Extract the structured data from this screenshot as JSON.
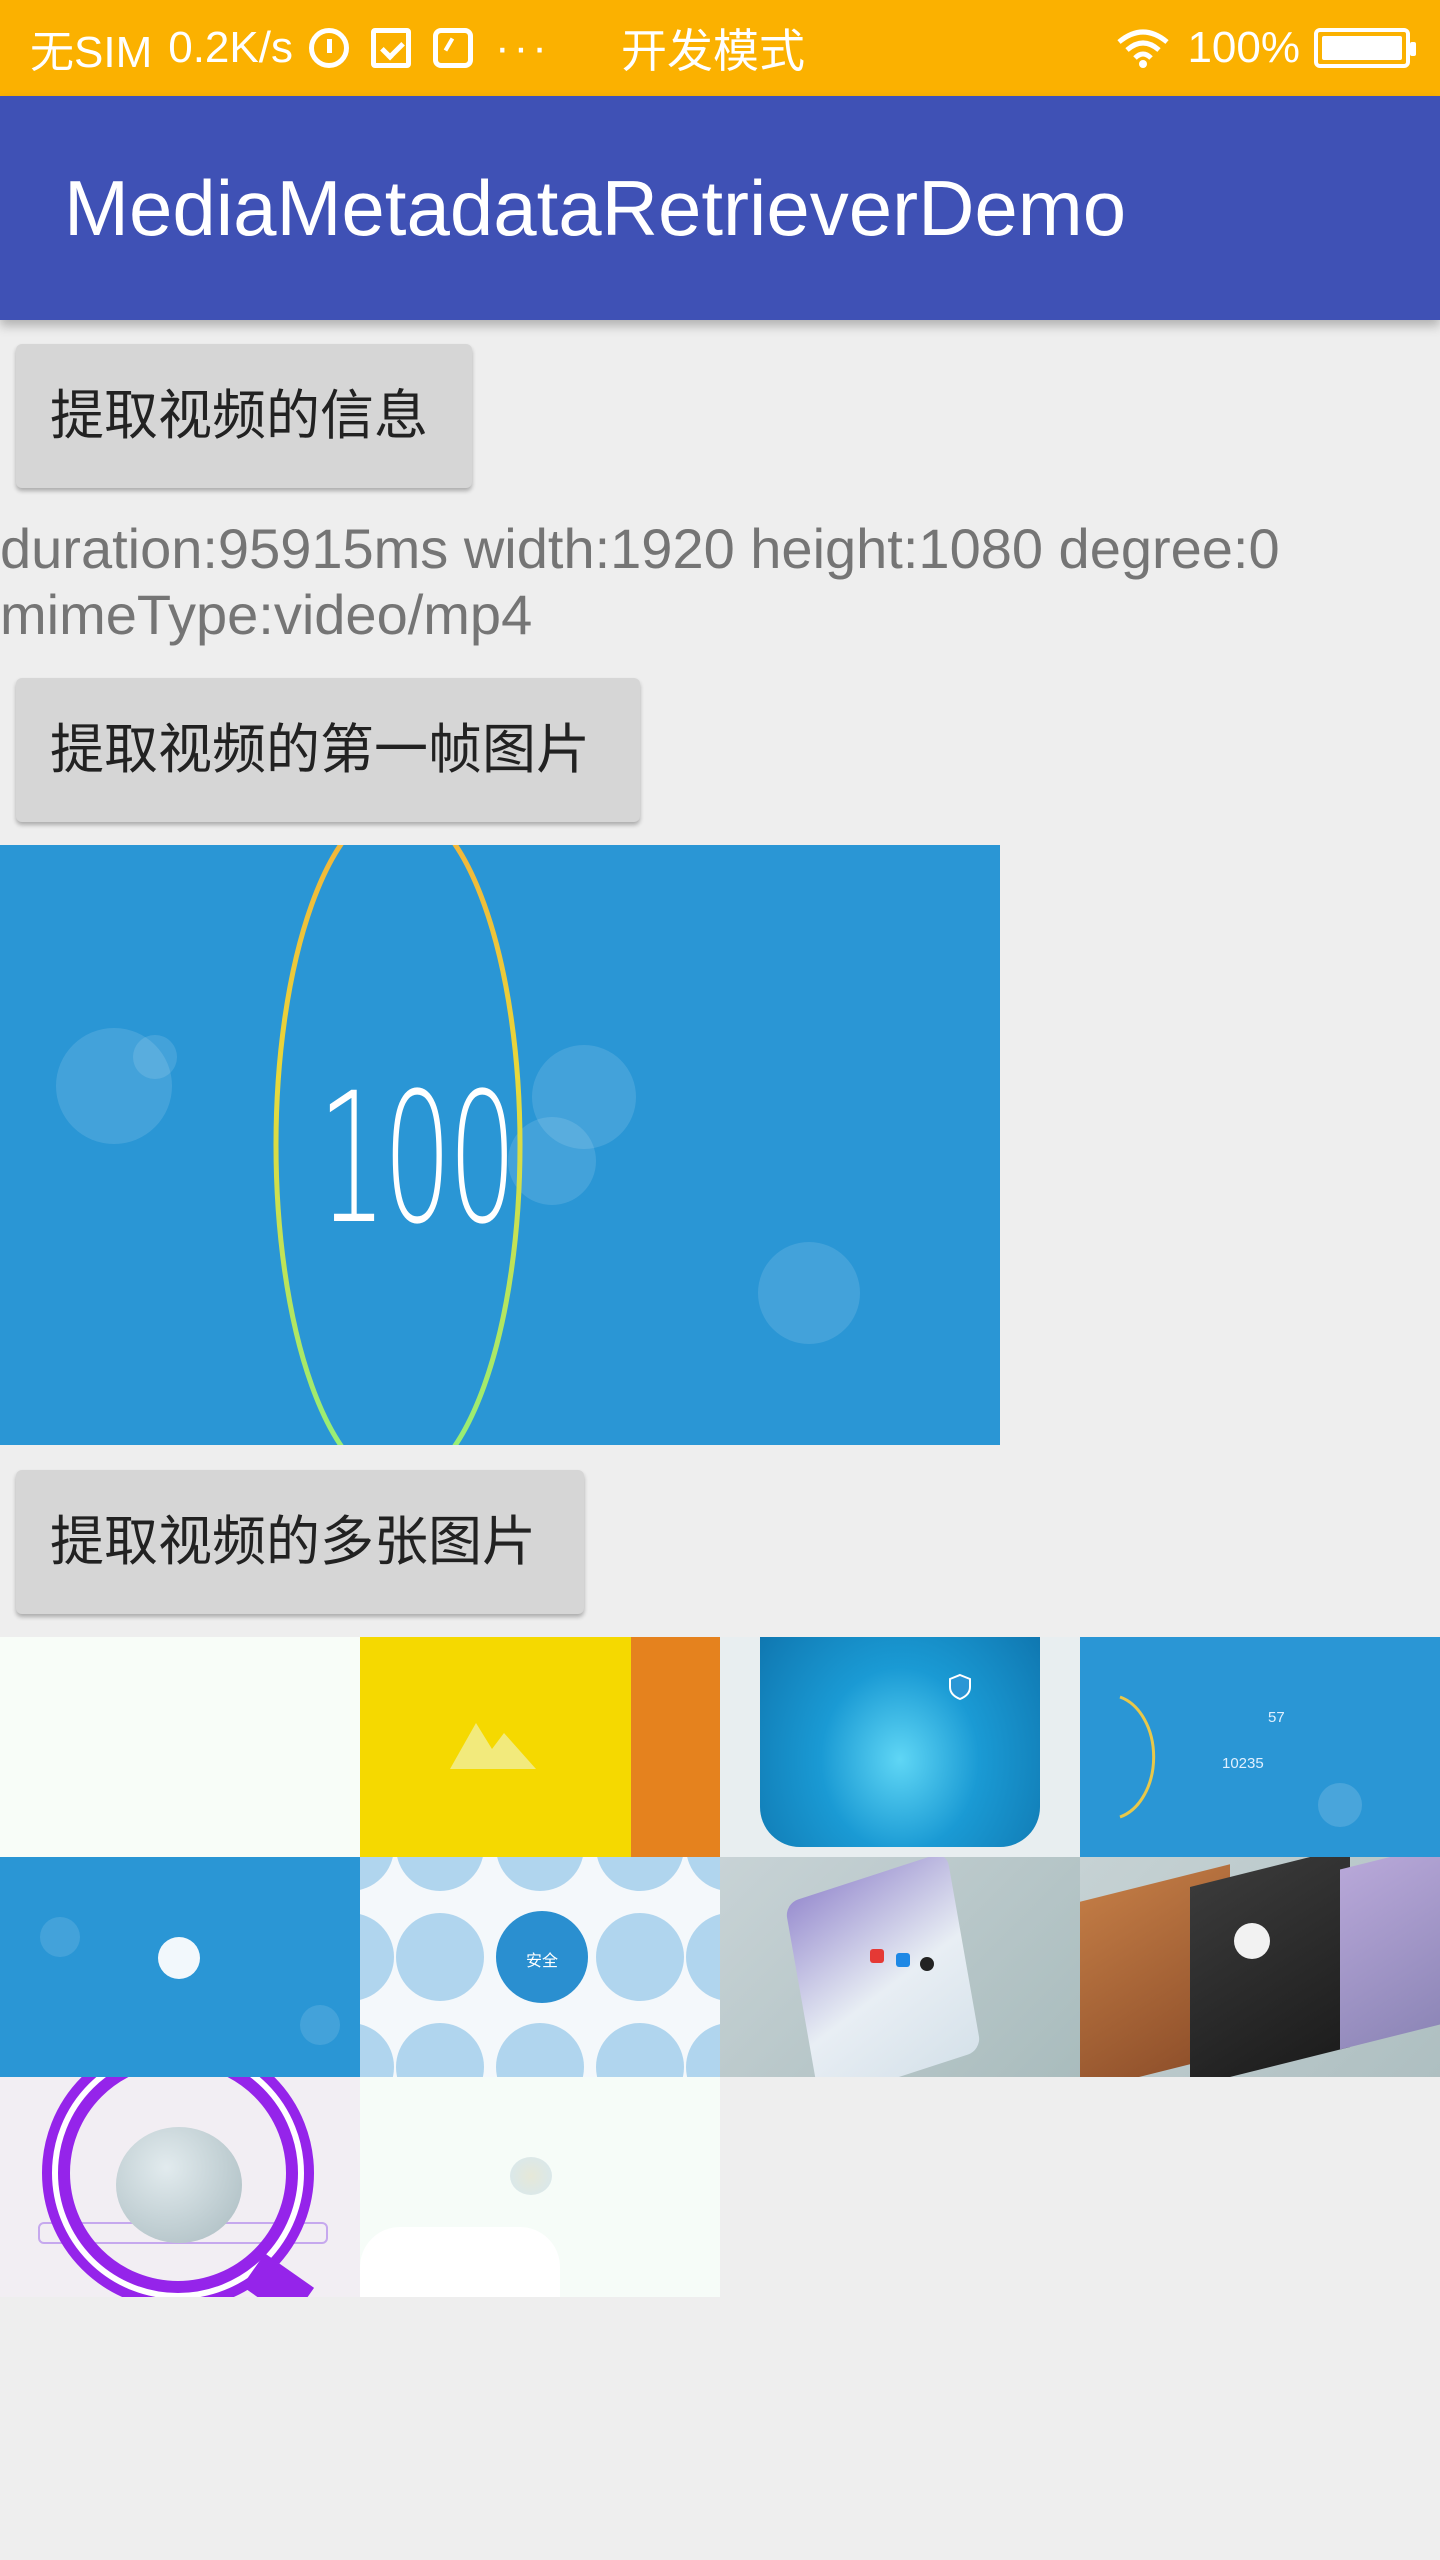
{
  "status_bar": {
    "carrier": "无SIM",
    "speed": "0.2K/s",
    "dots": "···",
    "dev_mode": "开发模式",
    "battery": "100%"
  },
  "app_bar": {
    "title": "MediaMetadataRetrieverDemo"
  },
  "buttons": {
    "extract_info": "提取视频的信息",
    "extract_first_frame": "提取视频的第一帧图片",
    "extract_multiple": "提取视频的多张图片"
  },
  "info_text": {
    "line1": "duration:95915ms width:1920 height:1080 degree:0",
    "line2": "mimeType:video/mp4"
  },
  "first_frame": {
    "number_text": "100"
  },
  "thumbnails": {
    "badge_text": "安全",
    "t4_text": "57",
    "t4_text2": "10235"
  },
  "colors": {
    "status_bar": "#fbb100",
    "app_bar": "#3f51b5",
    "frame_bg": "#2a96d5",
    "button_bg": "#d6d6d6"
  }
}
